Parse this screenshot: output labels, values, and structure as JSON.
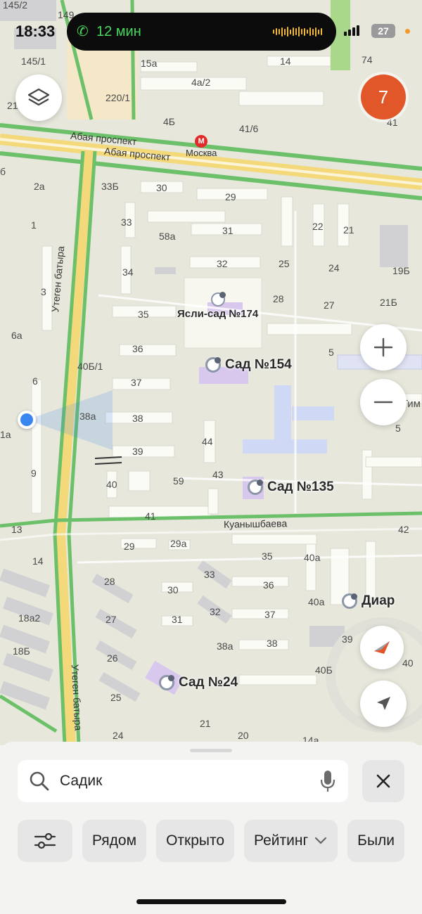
{
  "status_bar": {
    "time": "18:33",
    "call_duration": "12 мин",
    "battery": "27"
  },
  "map": {
    "notification_count": "7",
    "streets": [
      "Абая проспект",
      "Абая проспект",
      "Утеген батыра",
      "Куанышбаева",
      "Утеген батыра"
    ],
    "metro": "Москва",
    "pois": [
      {
        "name": "Ясли-сад №174"
      },
      {
        "name": "Сад №154"
      },
      {
        "name": "Сад №135"
      },
      {
        "name": "Сад №24"
      },
      {
        "name": "Диар"
      }
    ],
    "cut_label": "Гим",
    "house_numbers": [
      "145/2",
      "149",
      "145/1",
      "220/1",
      "21",
      "15а",
      "4а/2",
      "14",
      "74",
      "41",
      "4Б",
      "41/6",
      "2а",
      "33Б",
      "30",
      "29",
      "1",
      "33",
      "58а",
      "31",
      "22",
      "21",
      "34",
      "32",
      "25",
      "24",
      "19Б",
      "3",
      "35",
      "28",
      "27",
      "21Б",
      "6а",
      "36",
      "5",
      "40Б/1",
      "6",
      "37",
      "38а",
      "38",
      "5",
      "39",
      "44",
      "9",
      "40",
      "59",
      "43",
      "1а",
      "41",
      "13",
      "42",
      "29",
      "29а",
      "35",
      "40а",
      "14",
      "28",
      "30",
      "33",
      "36",
      "40а",
      "18а2",
      "27",
      "31",
      "32",
      "37",
      "18Б",
      "38а",
      "38",
      "39",
      "26",
      "40",
      "25",
      "40Б",
      "24",
      "21",
      "20",
      "14а",
      "6",
      "б"
    ]
  },
  "search": {
    "value": "Садик"
  },
  "chips": [
    "Рядом",
    "Открыто",
    "Рейтинг",
    "Были"
  ],
  "colors": {
    "accent_orange": "#e2572a",
    "user_location": "#3a86f0",
    "call_green": "#47d75e",
    "road_green": "#5fc162"
  }
}
